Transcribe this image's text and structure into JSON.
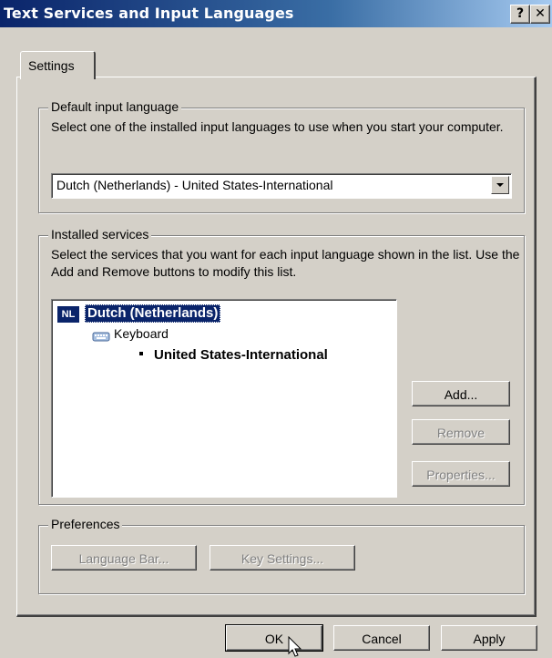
{
  "window": {
    "title": "Text Services and Input Languages",
    "help_button": "?",
    "close_button": "✕"
  },
  "tabs": [
    {
      "label": "Settings",
      "selected": true
    }
  ],
  "default_input_language": {
    "legend": "Default input language",
    "description": "Select one of the installed input languages to use when you start your computer.",
    "selected_value": "Dutch (Netherlands) - United States-International"
  },
  "installed_services": {
    "legend": "Installed services",
    "description": "Select the services that you want for each input language shown in the list. Use the Add and Remove buttons to modify this list.",
    "tree": {
      "language_badge": "NL",
      "language_name": "Dutch (Netherlands)",
      "category": "Keyboard",
      "layout": "United States-International"
    },
    "buttons": {
      "add": "Add...",
      "remove": "Remove",
      "properties": "Properties..."
    }
  },
  "preferences": {
    "legend": "Preferences",
    "language_bar": "Language Bar...",
    "key_settings": "Key Settings..."
  },
  "footer": {
    "ok": "OK",
    "cancel": "Cancel",
    "apply": "Apply"
  }
}
